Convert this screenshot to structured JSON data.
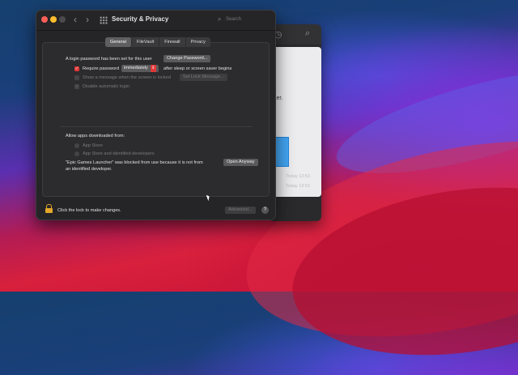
{
  "window": {
    "title": "Security & Privacy",
    "back": "‹",
    "forward": "›",
    "search_placeholder": "Search"
  },
  "tabs": [
    {
      "label": "General",
      "active": true
    },
    {
      "label": "FileVault",
      "active": false
    },
    {
      "label": "Firewall",
      "active": false
    },
    {
      "label": "Privacy",
      "active": false
    }
  ],
  "general": {
    "login_text": "A login password has been set for this user",
    "change_password_button": "Change Password...",
    "require_password_label": "Require password",
    "require_password_checked": true,
    "require_password_value": "immediately",
    "after_sleep_text": "after sleep or screen saver begins",
    "show_message_label": "Show a message when the screen is locked",
    "set_lock_message_button": "Set Lock Message...",
    "disable_autologin_label": "Disable automatic login"
  },
  "apps": {
    "heading": "Allow apps downloaded from:",
    "options": [
      {
        "label": "App Store",
        "selected": false
      },
      {
        "label": "App Store and identified developers",
        "selected": false
      }
    ],
    "blocked_line1": "\"Epic Games Launcher\" was blocked from use because it is not from",
    "blocked_line2": "an identified developer.",
    "open_anyway_button": "Open Anyway"
  },
  "footer": {
    "lock_text": "Click the lock to make changes.",
    "advanced_button": "Advanced...",
    "help": "?"
  },
  "background_window": {
    "partial_text": "lder.",
    "times": [
      "Today 13:53",
      "Today 13:53"
    ]
  },
  "colors": {
    "accent": "#e03838",
    "lock": "#e2a72b",
    "window_bg": "#252527"
  }
}
